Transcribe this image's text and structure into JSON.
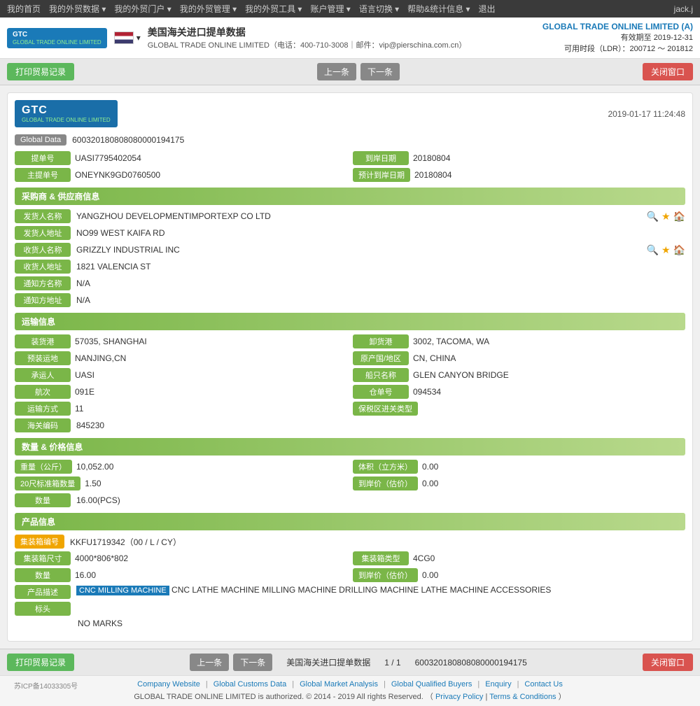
{
  "topnav": {
    "items": [
      "我的首页",
      "我的外贸数据",
      "我的外贸门户",
      "我的外贸管理",
      "我的外贸工具",
      "账户管理",
      "语言切换",
      "帮助&统计信息",
      "退出"
    ],
    "user": "jack.j"
  },
  "header": {
    "title": "美国海关进口提单数据",
    "company_line": "GLOBAL TRADE ONLINE LIMITED（电话：400-710-3008｜邮件：vip@pierschina.com.cn）",
    "right_company": "GLOBAL TRADE ONLINE LIMITED (A)",
    "valid_until_label": "有效期至",
    "valid_until": "2019-12-31",
    "ldr_label": "可用时段（LDR）：200712 ～ 201812"
  },
  "toolbar": {
    "print_btn": "打印贸易记录",
    "prev_btn": "上一条",
    "next_btn": "下一条",
    "close_btn": "关闭窗口"
  },
  "record": {
    "datetime": "2019-01-17  11:24:48",
    "global_data_label": "Global Data",
    "global_data_value": "600320180808080000194175",
    "fields": {
      "bill_no_label": "提单号",
      "bill_no_value": "UASI7795402054",
      "arrival_date_label": "到岸日期",
      "arrival_date_value": "20180804",
      "main_bill_label": "主提单号",
      "main_bill_value": "ONEYNK9GD0760500",
      "estimated_arrival_label": "预计到岸日期",
      "estimated_arrival_value": "20180804"
    }
  },
  "buyer_supplier": {
    "section_title": "采购商 & 供应商信息",
    "shipper_name_label": "发货人名称",
    "shipper_name_value": "YANGZHOU DEVELOPMENTIMPORTEXP CO LTD",
    "shipper_addr_label": "发货人地址",
    "shipper_addr_value": "NO99 WEST KAIFA RD",
    "consignee_name_label": "收货人名称",
    "consignee_name_value": "GRIZZLY INDUSTRIAL INC",
    "consignee_addr_label": "收货人地址",
    "consignee_addr_value": "1821 VALENCIA ST",
    "notify_name_label": "通知方名称",
    "notify_name_value": "N/A",
    "notify_addr_label": "通知方地址",
    "notify_addr_value": "N/A"
  },
  "transport": {
    "section_title": "运输信息",
    "departure_port_label": "装货港",
    "departure_port_value": "57035, SHANGHAI",
    "arrival_port_label": "卸货港",
    "arrival_port_value": "3002, TACOMA, WA",
    "pre_transport_label": "预装运地",
    "pre_transport_value": "NANJING,CN",
    "origin_region_label": "原产国/地区",
    "origin_region_value": "CN, CHINA",
    "carrier_label": "承运人",
    "carrier_value": "UASI",
    "vessel_name_label": "船只名称",
    "vessel_name_value": "GLEN CANYON BRIDGE",
    "voyage_label": "航次",
    "voyage_value": "091E",
    "warehouse_no_label": "仓单号",
    "warehouse_no_value": "094534",
    "transport_mode_label": "运输方式",
    "transport_mode_value": "11",
    "customs_zone_label": "保税区进关类型",
    "customs_zone_value": "",
    "customs_code_label": "海关编码",
    "customs_code_value": "845230"
  },
  "quantity_price": {
    "section_title": "数量 & 价格信息",
    "weight_label": "重量（公斤）",
    "weight_value": "10,052.00",
    "volume_label": "体积（立方米）",
    "volume_value": "0.00",
    "container20_label": "20尺标准箱数量",
    "container20_value": "1.50",
    "arrival_price_label": "到岸价（估价）",
    "arrival_price_value": "0.00",
    "quantity_label": "数量",
    "quantity_value": "16.00(PCS)"
  },
  "product_info": {
    "section_title": "产品信息",
    "container_no_label": "集装箱编号",
    "container_no_value": "KKFU1719342（00 / L / CY）",
    "container_size_label": "集装箱尺寸",
    "container_size_value": "4000*806*802",
    "container_type_label": "集装箱类型",
    "container_type_value": "4CG0",
    "quantity_label": "数量",
    "quantity_value": "16.00",
    "arrival_price_label": "到岸价（估价）",
    "arrival_price_value": "0.00",
    "desc_label": "产品描述",
    "desc_highlight": "CNC MILLING MACHINE",
    "desc_rest": " CNC LATHE MACHINE MILLING MACHINE DRILLING MACHINE LATHE MACHINE ACCESSORIES",
    "marks_label": "标头",
    "marks_value": "NO MARKS"
  },
  "pagination": {
    "bill_label": "美国海关进口提单数据",
    "current": "1 / 1",
    "record_id": "600320180808080000194175"
  },
  "footer": {
    "links": [
      "Company Website",
      "Global Customs Data",
      "Global Market Analysis",
      "Global Qualified Buyers",
      "Enquiry",
      "Contact Us"
    ],
    "copyright": "GLOBAL TRADE ONLINE LIMITED is authorized. © 2014 - 2019 All rights Reserved.  （",
    "privacy": "Privacy Policy",
    "terms": "Terms & Conditions",
    "copyright_end": "）",
    "icp": "苏ICP备14033305号"
  }
}
